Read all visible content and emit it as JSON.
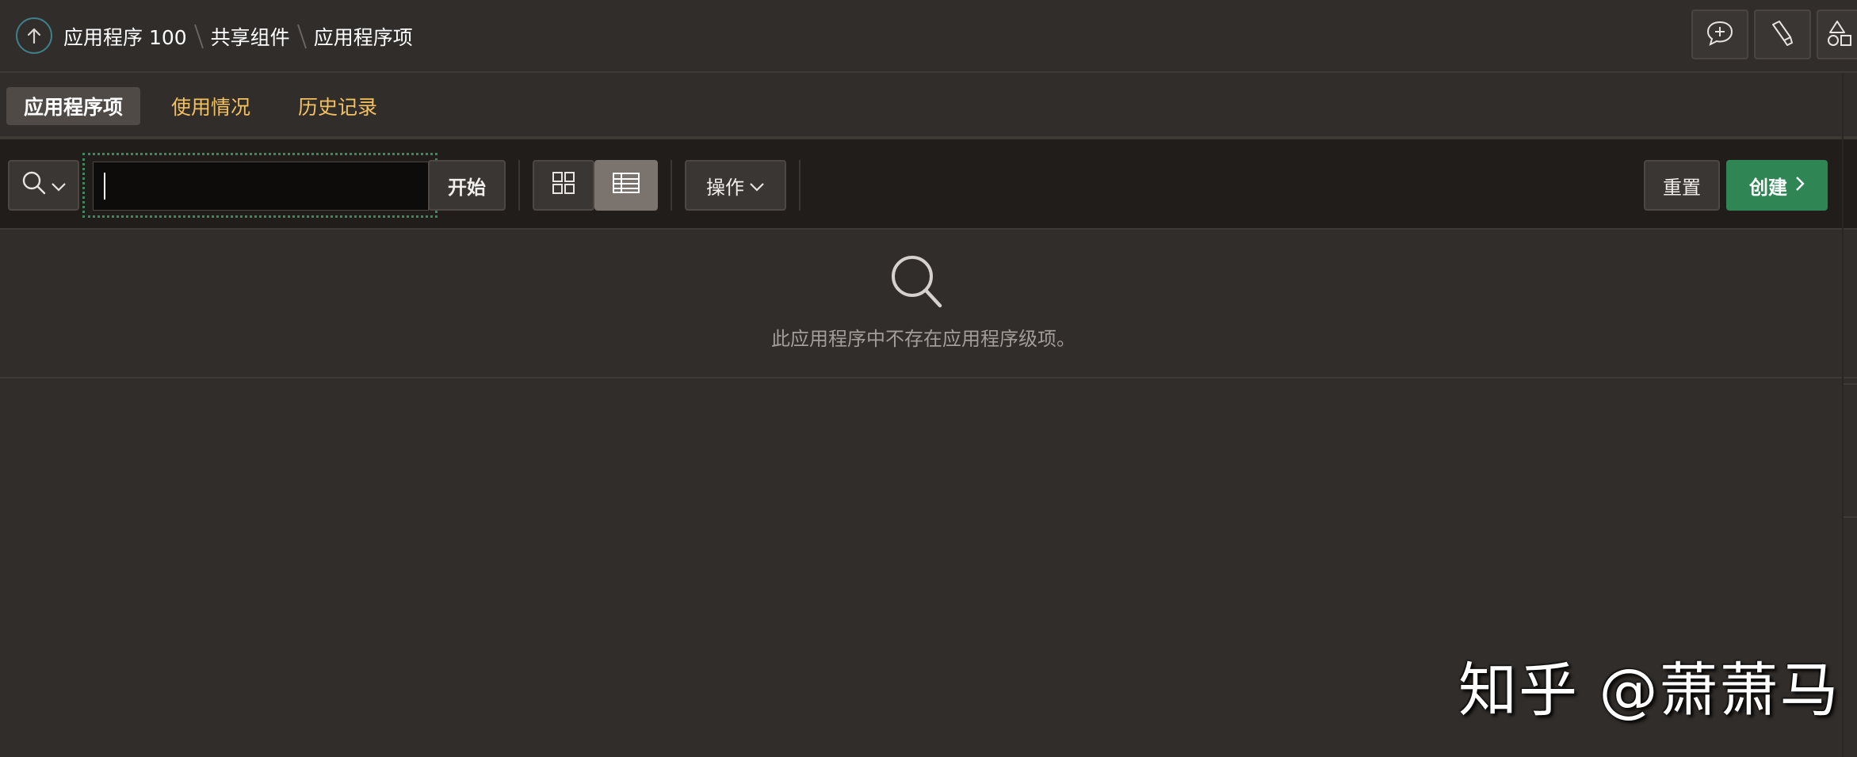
{
  "breadcrumb": {
    "items": [
      "应用程序 100",
      "共享组件",
      "应用程序项"
    ]
  },
  "header": {
    "icons": [
      "comment-plus-icon",
      "brush-icon",
      "shapes-icon"
    ]
  },
  "tabs": [
    {
      "label": "应用程序项",
      "active": true
    },
    {
      "label": "使用情况",
      "active": false
    },
    {
      "label": "历史记录",
      "active": false
    }
  ],
  "toolbar": {
    "search_value": "",
    "go_label": "开始",
    "actions_label": "操作",
    "reset_label": "重置",
    "create_label": "创建"
  },
  "empty_state": {
    "message": "此应用程序中不存在应用程序级项。"
  },
  "watermark": "知乎 @萧萧马",
  "colors": {
    "background": "#312d2a",
    "toolbar": "#201d1b",
    "tab_inactive": "#f4c15f",
    "create": "#2f8654",
    "focus_ring": "#3b8a5f"
  }
}
